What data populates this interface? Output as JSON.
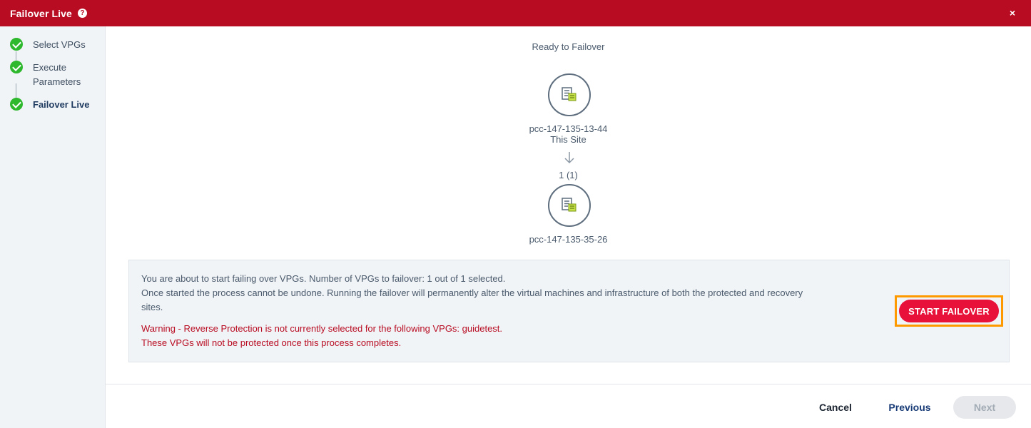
{
  "dialog": {
    "title": "Failover Live",
    "help_icon": "?",
    "close_icon": "×"
  },
  "steps": [
    {
      "label": "Select VPGs",
      "status": "complete"
    },
    {
      "label": "Execute\nParameters",
      "status": "complete"
    },
    {
      "label": "Failover Live",
      "status": "complete",
      "active": true
    }
  ],
  "topology": {
    "status": "Ready to Failover",
    "source_site": "pcc-147-135-13-44",
    "source_sublabel": "This Site",
    "vpg_count": "1 (1)",
    "target_site": "pcc-147-135-35-26"
  },
  "info": {
    "line1": "You are about to start failing over VPGs. Number of VPGs to failover: 1 out of 1 selected.",
    "line2": "Once started the process cannot be undone. Running the failover will permanently alter the virtual machines and infrastructure of both the protected and recovery sites.",
    "warning1": "Warning - Reverse Protection is not currently selected for the following VPGs: guidetest.",
    "warning2": "These VPGs will not be protected once this process completes.",
    "start_button": "START FAILOVER"
  },
  "footer": {
    "cancel": "Cancel",
    "previous": "Previous",
    "next": "Next"
  },
  "colors": {
    "brand": "#b80c22",
    "start_button": "#e8113a",
    "highlight": "#ff9900",
    "success": "#2eb82e"
  }
}
